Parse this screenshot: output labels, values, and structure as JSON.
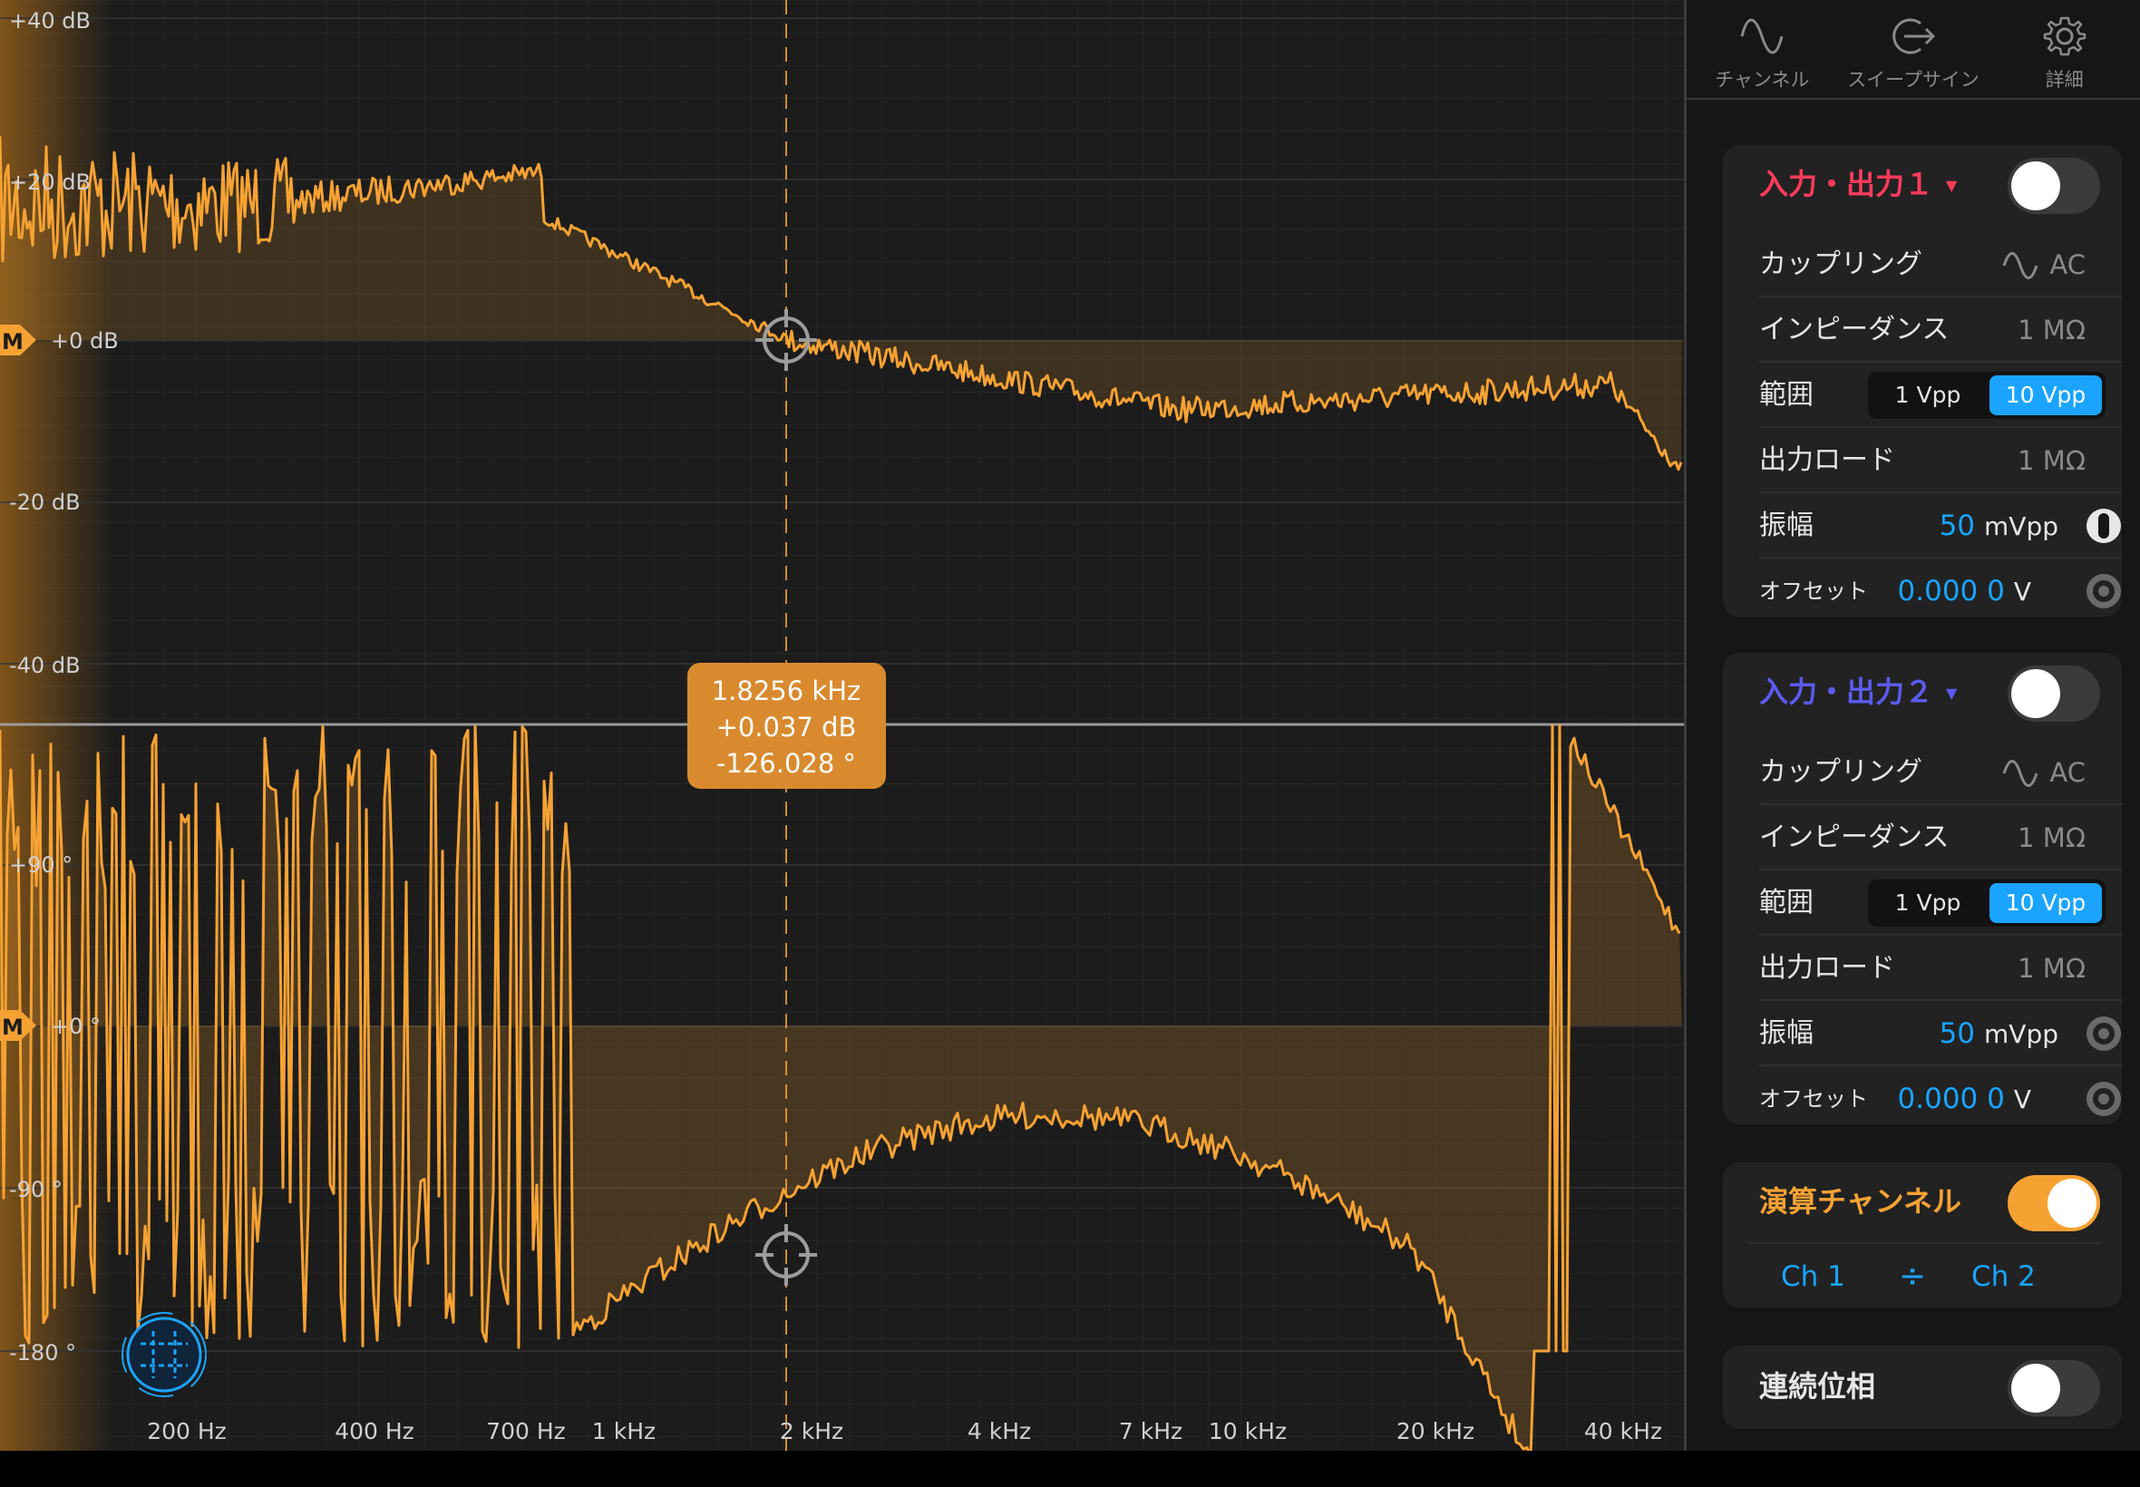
{
  "plot": {
    "mag_labels": [
      "+40 dB",
      "+20 dB",
      "+0 dB",
      "-20 dB",
      "-40 dB"
    ],
    "phase_labels": [
      "+90 °",
      "+0 °",
      "-90 °",
      "-180 °"
    ],
    "freq_labels": [
      "200 Hz",
      "400 Hz",
      "700 Hz",
      "1 kHz",
      "2 kHz",
      "4 kHz",
      "7 kHz",
      "10 kHz",
      "20 kHz",
      "40 kHz"
    ],
    "marker_label": "M",
    "cursor": {
      "freq": "1.8256 kHz",
      "mag": "+0.037 dB",
      "phase": "-126.028 °"
    },
    "trace_color": "#f5a233"
  },
  "nav": {
    "tabs": [
      {
        "label": "チャンネル",
        "icon": "sine-wave-icon"
      },
      {
        "label": "スイープサイン",
        "icon": "sweep-output-icon"
      },
      {
        "label": "詳細",
        "icon": "gear-icon"
      }
    ]
  },
  "ch1": {
    "title": "入力・出力１",
    "color": "#ff3b5c",
    "coupling_label": "カップリング",
    "coupling_value": "AC",
    "impedance_label": "インピーダンス",
    "impedance_value": "1 MΩ",
    "range_label": "範囲",
    "range_opt1": "1 Vpp",
    "range_opt2": "10 Vpp",
    "load_label": "出力ロード",
    "load_value": "1 MΩ",
    "amp_label": "振幅",
    "amp_value": "50",
    "amp_unit": "mVpp",
    "offset_label": "オフセット",
    "offset_value": "0.000 0",
    "offset_unit": "V"
  },
  "ch2": {
    "title": "入力・出力２",
    "color": "#5b5bf0",
    "coupling_label": "カップリング",
    "coupling_value": "AC",
    "impedance_label": "インピーダンス",
    "impedance_value": "1 MΩ",
    "range_label": "範囲",
    "range_opt1": "1 Vpp",
    "range_opt2": "10 Vpp",
    "load_label": "出力ロード",
    "load_value": "1 MΩ",
    "amp_label": "振幅",
    "amp_value": "50",
    "amp_unit": "mVpp",
    "offset_label": "オフセット",
    "offset_value": "0.000 0",
    "offset_unit": "V"
  },
  "math": {
    "title": "演算チャンネル",
    "ch_a": "Ch 1",
    "op": "÷",
    "ch_b": "Ch 2",
    "enabled": true
  },
  "unwrap": {
    "title": "連続位相",
    "enabled": false
  }
}
